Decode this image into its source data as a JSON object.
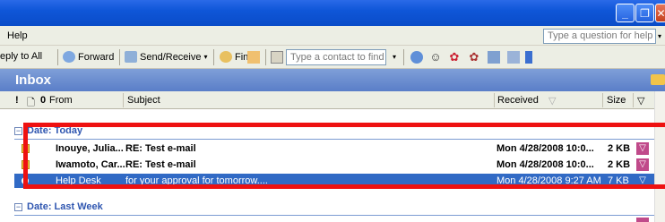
{
  "window": {
    "minimize_glyph": "_",
    "restore_glyph": "❐",
    "close_glyph": "✕"
  },
  "menubar": {
    "help_label": "Help",
    "ask_placeholder": "Type a question for help",
    "ask_arrow": "▾"
  },
  "toolbar": {
    "reply_all_label": "eply to All",
    "forward_label": "Forward",
    "send_receive_label": "Send/Receive",
    "find_label": "Find",
    "contact_placeholder": "Type a contact to find",
    "dropdown_glyph": "▾"
  },
  "inbox": {
    "title": "Inbox"
  },
  "columns": {
    "importance": "!",
    "icon": "🗋",
    "attachment": "0",
    "from": "From",
    "subject": "Subject",
    "received": "Received",
    "received_sort": "▽",
    "size": "Size",
    "flag": "▽"
  },
  "groups": [
    {
      "label": "Date: Today",
      "expander": "−",
      "rows": [
        {
          "from": "Inouye, Julia...",
          "subject": "RE: Test e-mail",
          "received": "Mon 4/28/2008 10:0...",
          "size": "2 KB",
          "flag_glyph": "▽",
          "unread": true,
          "selected": false
        },
        {
          "from": "Iwamoto, Car...",
          "subject": "RE: Test e-mail",
          "received": "Mon 4/28/2008 10:0...",
          "size": "2 KB",
          "flag_glyph": "▽",
          "unread": true,
          "selected": false
        },
        {
          "from": "Help Desk",
          "subject": "for your approval for tomorrow....",
          "received": "Mon 4/28/2008 9:27 AM",
          "size": "7 KB",
          "flag_glyph": "▽",
          "unread": false,
          "selected": true
        }
      ]
    },
    {
      "label": "Date: Last Week",
      "expander": "−"
    }
  ],
  "colors": {
    "titlebar": "#0a4cc8",
    "inbox_header": "#5a7ec8",
    "selection": "#316ac5",
    "group_label": "#2f56b0",
    "annotation_red": "#ee1111",
    "flag_magenta": "#c04a8a"
  },
  "icons": {
    "reply_all": "reply-all-icon",
    "forward": "forward-icon",
    "send_receive": "send-receive-icon",
    "find": "find-icon",
    "organize": "organize-icon",
    "address_book": "address-book-icon"
  }
}
